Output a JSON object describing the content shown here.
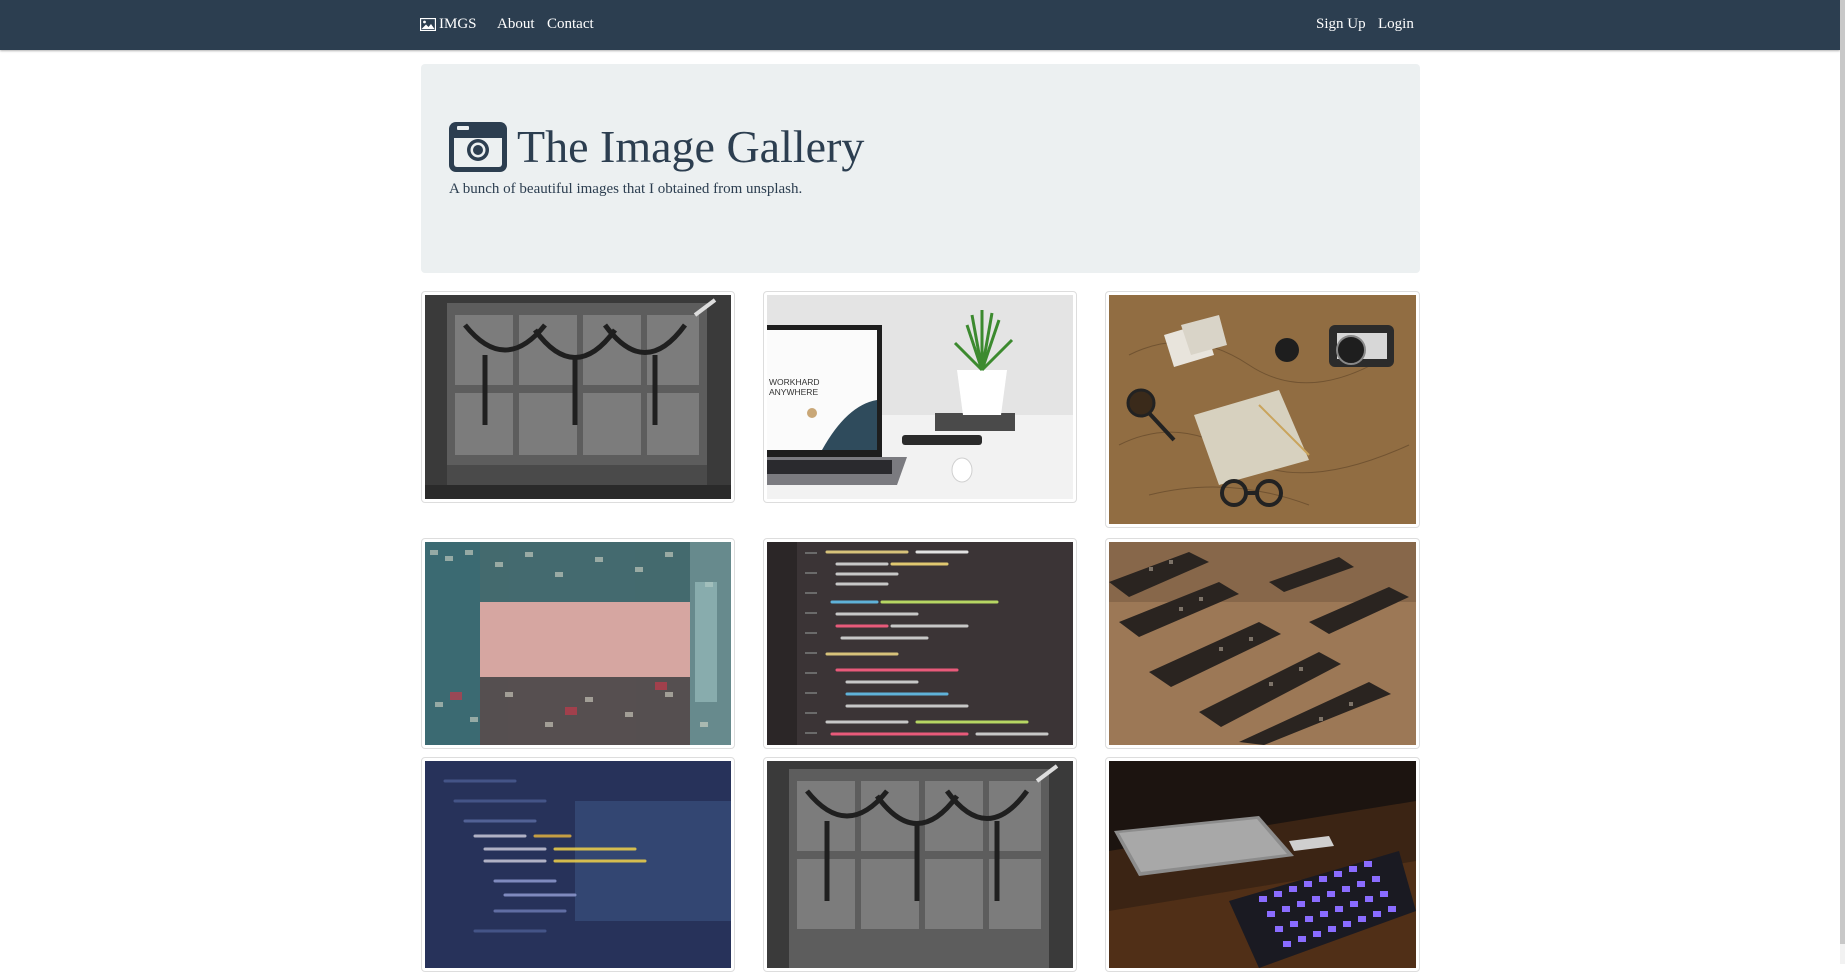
{
  "navbar": {
    "brand": "IMGS",
    "brand_icon": "image-icon",
    "links": [
      "About",
      "Contact"
    ],
    "right_links": [
      "Sign Up",
      "Login"
    ],
    "background": "#2c3e50"
  },
  "hero": {
    "title": "The Image Gallery",
    "subtitle": "A bunch of beautiful images that I obtained from unsplash.",
    "icon": "camera-icon",
    "background": "#ecf0f1"
  },
  "gallery": {
    "images": [
      {
        "name": "server-rack-photo"
      },
      {
        "name": "laptop-plant-photo",
        "overlay_text": [
          "WORKHARD",
          "ANYWHERE"
        ]
      },
      {
        "name": "map-camera-notebook-photo"
      },
      {
        "name": "buildings-sky-photo"
      },
      {
        "name": "code-screen-photo"
      },
      {
        "name": "circuit-board-photo"
      },
      {
        "name": "code-blue-screen-photo"
      },
      {
        "name": "server-rack-photo-2"
      },
      {
        "name": "keyboard-laptop-photo"
      }
    ]
  }
}
